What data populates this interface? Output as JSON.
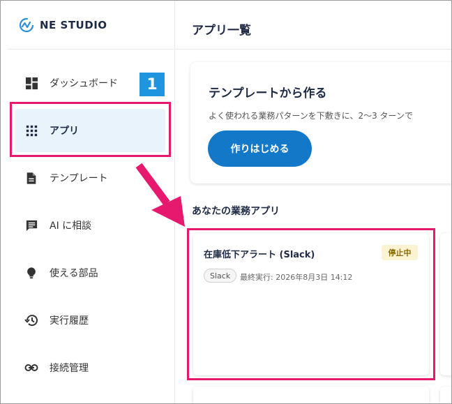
{
  "brand": {
    "name": "NE STUDIO",
    "logo_icon": "wave-circle-logo"
  },
  "sidebar": {
    "items": [
      {
        "label": "ダッシュボード",
        "icon": "dashboard-icon"
      },
      {
        "label": "アプリ",
        "icon": "apps-grid-icon",
        "active": true
      },
      {
        "label": "テンプレート",
        "icon": "document-icon"
      },
      {
        "label": "AI に相談",
        "icon": "chat-icon"
      },
      {
        "label": "使える部品",
        "icon": "lightbulb-icon"
      },
      {
        "label": "実行履歴",
        "icon": "history-icon"
      },
      {
        "label": "接続管理",
        "icon": "link-icon"
      }
    ]
  },
  "annotation": {
    "step_number": "1",
    "color": "#e6196e",
    "badge_color": "#1f95e0"
  },
  "main": {
    "title": "アプリ一覧",
    "template_card": {
      "title": "テンプレートから作る",
      "description": "よく使われる業務パターンを下敷きに、2〜3 ターンで",
      "button_label": "作りはじめる"
    },
    "section_heading": "あなたの業務アプリ",
    "apps": [
      {
        "name": "在庫低下アラート (Slack)",
        "status": "停止中",
        "tag": "Slack",
        "last_run": "最終実行: 2026年8月3日 14:12"
      }
    ]
  },
  "colors": {
    "accent": "#1478c8",
    "active_bg": "#e8f3fc",
    "status_bg": "#fbf3d2",
    "status_text": "#8a6a00"
  }
}
